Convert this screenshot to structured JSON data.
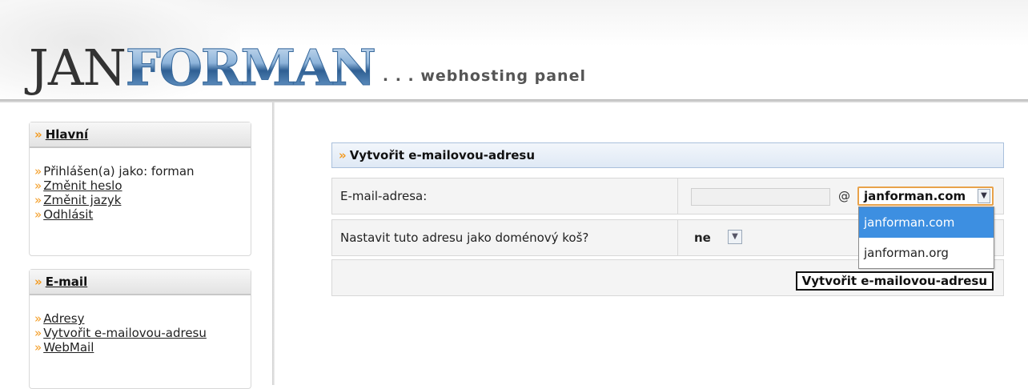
{
  "header": {
    "logo_part1": "JAN",
    "logo_part2": "FORMAN",
    "tagline": ". . . webhosting panel"
  },
  "sidebar": {
    "main_box": {
      "title": "Hlavní",
      "items": [
        {
          "label": "Přihlášen(a) jako: forman",
          "link": false
        },
        {
          "label": "Změnit heslo",
          "link": true
        },
        {
          "label": "Změnit jazyk",
          "link": true
        },
        {
          "label": "Odhlásit",
          "link": true
        }
      ]
    },
    "email_box": {
      "title": "E-mail",
      "items": [
        {
          "label": "Adresy",
          "link": true
        },
        {
          "label": "Vytvořit e-mailovou-adresu",
          "link": true
        },
        {
          "label": "WebMail",
          "link": true
        }
      ]
    }
  },
  "form": {
    "title": "Vytvořit e-mailovou-adresu",
    "email_label": "E-mail-adresa:",
    "email_value": "",
    "at_sign": "@",
    "domain_selected": "janforman.com",
    "domain_options": [
      "janforman.com",
      "janforman.org"
    ],
    "catchall_label": "Nastavit tuto adresu jako doménový koš?",
    "catchall_value": "ne",
    "submit_label": "Vytvořit e-mailovou-adresu"
  },
  "colors": {
    "accent_orange": "#f39a1f",
    "dropdown_highlight": "#3d8fe1",
    "title_bar_border": "#a9c0dc"
  }
}
